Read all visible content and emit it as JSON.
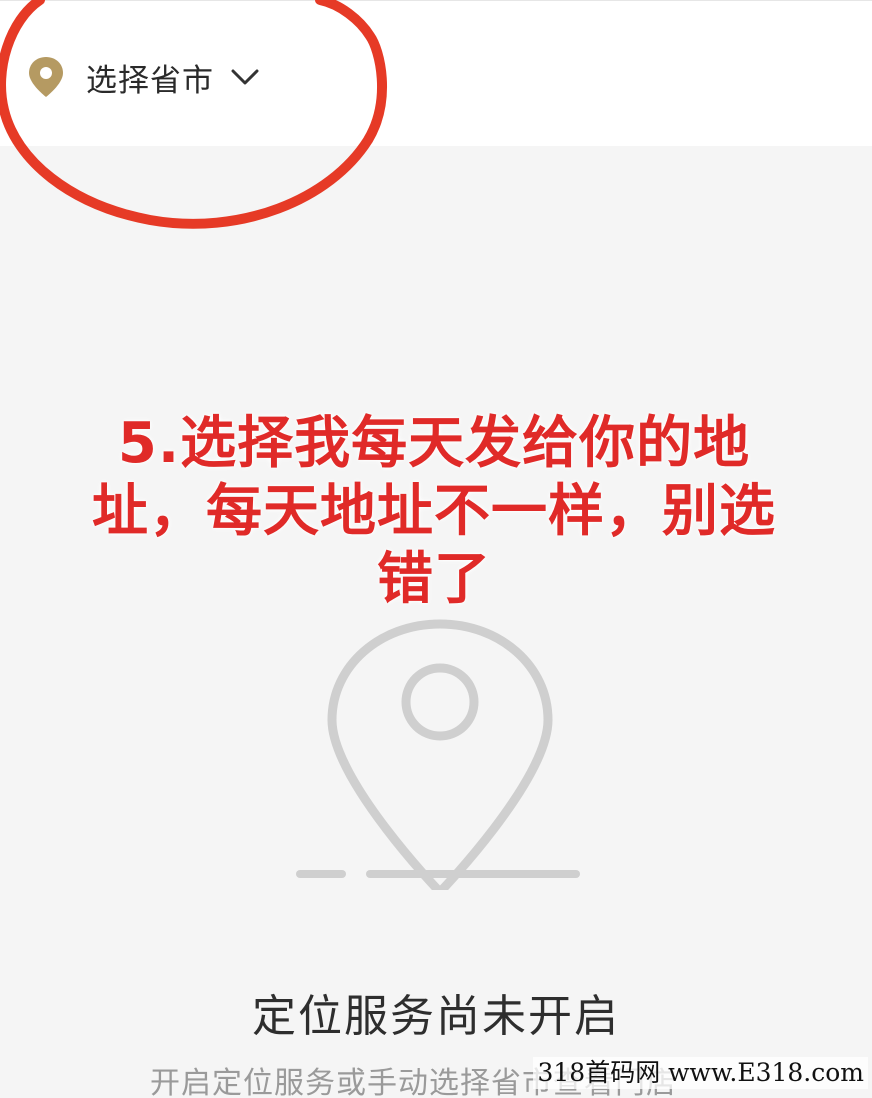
{
  "header": {
    "region_selector_label": "选择省市"
  },
  "annotation": {
    "instruction_text": "5.选择我每天发给你的地址，每天地址不一样，别选错了"
  },
  "empty_state": {
    "title": "定位服务尚未开启",
    "hint": "开启定位服务或手动选择省市查看门店"
  },
  "watermark": {
    "text": "318首码网 www.E318.com"
  },
  "colors": {
    "pin_gold": "#b59a62",
    "annotation_red": "#e02a28",
    "illustration_gray": "#cfcfcf"
  },
  "icons": {
    "region_pin": "location-pin-icon",
    "dropdown": "chevron-down-icon",
    "empty_illustration": "location-pin-illustration"
  }
}
